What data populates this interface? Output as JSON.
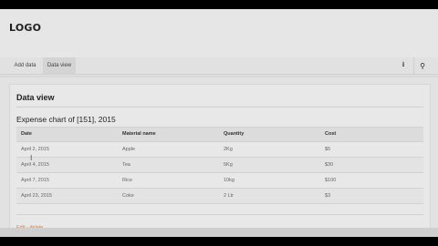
{
  "header": {
    "logo": "LOGO"
  },
  "nav": {
    "tabs": [
      {
        "label": "Add data"
      },
      {
        "label": "Data view"
      }
    ],
    "buttons": [
      {
        "icon": "upload-icon",
        "glyph": "⭳"
      },
      {
        "icon": "search-icon",
        "glyph": "⚲"
      }
    ]
  },
  "panel": {
    "title": "Data view",
    "table_title": "Expense chart of [151], 2015",
    "columns": [
      "Date",
      "Material name",
      "Quantity",
      "Cost"
    ],
    "rows": [
      [
        "April 2, 2015",
        "Apple",
        "2Kg",
        "$5"
      ],
      [
        "April 4, 2015",
        "Tea",
        "5Kg",
        "$30"
      ],
      [
        "April 7, 2015",
        "Rice",
        "10kg",
        "$100"
      ],
      [
        "April 23, 2015",
        "Coke",
        "2 Ltr",
        "$3"
      ]
    ],
    "actions": {
      "edit": "Edit",
      "separator": " - ",
      "delete": "delete"
    }
  }
}
